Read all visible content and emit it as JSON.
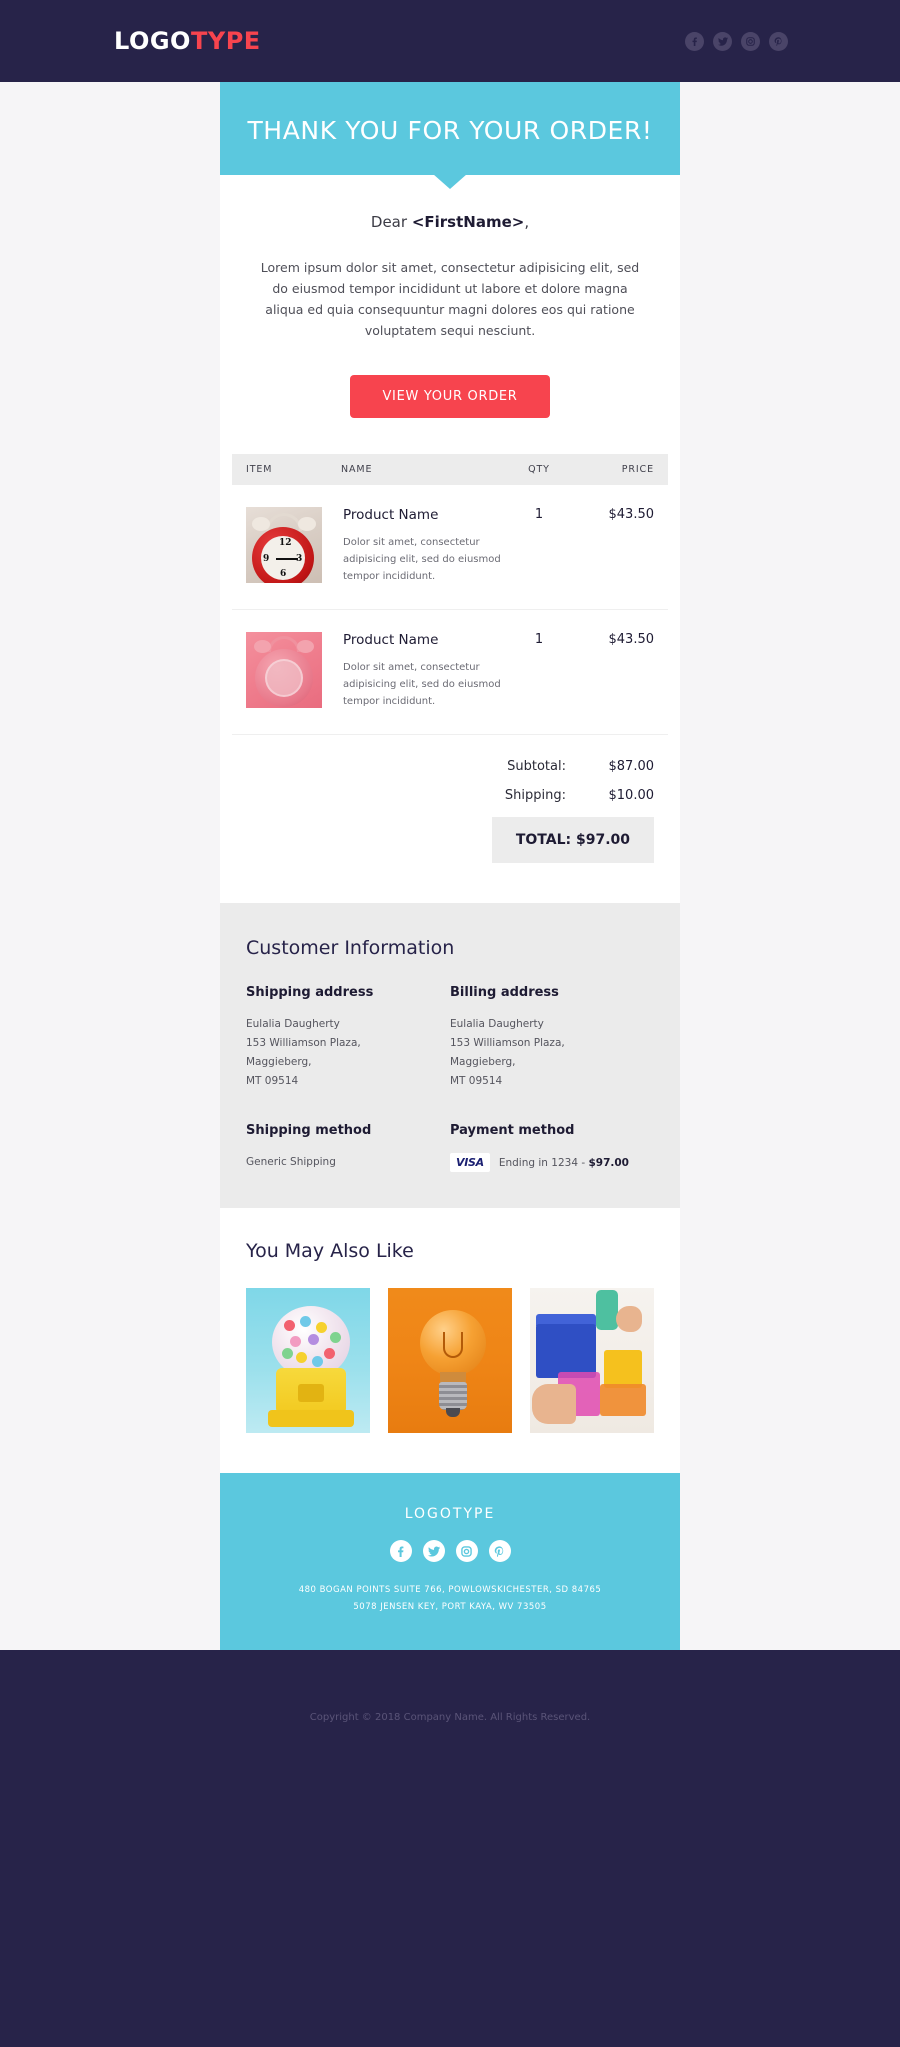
{
  "brand": {
    "logo_primary": "LOGO",
    "logo_accent": "TYPE",
    "accent_color": "#F7444E",
    "cyan_color": "#5BC8DE",
    "navy_color": "#272349"
  },
  "header": {
    "social": [
      {
        "name": "facebook-icon",
        "glyph": "f"
      },
      {
        "name": "twitter-icon",
        "glyph": "t"
      },
      {
        "name": "instagram-icon",
        "glyph": "i"
      },
      {
        "name": "pinterest-icon",
        "glyph": "p"
      }
    ]
  },
  "hero": {
    "title": "THANK YOU FOR YOUR ORDER!"
  },
  "intro": {
    "greeting_prefix": "Dear ",
    "greeting_name": "<FirstName>",
    "greeting_suffix": ",",
    "paragraph": "Lorem ipsum dolor sit amet, consectetur adipisicing elit, sed do eiusmod tempor incididunt ut labore et dolore magna aliqua ed quia consequuntur magni dolores eos qui ratione voluptatem sequi nesciunt.",
    "cta_label": "VIEW YOUR ORDER"
  },
  "order_table": {
    "columns": {
      "item": "ITEM",
      "name": "NAME",
      "qty": "QTY",
      "price": "PRICE"
    },
    "rows": [
      {
        "thumb": "red-alarm-clock-image",
        "name": "Product Name",
        "description": "Dolor sit amet, consectetur adipisicing elit, sed do eiusmod tempor incididunt.",
        "qty": "1",
        "price": "$43.50"
      },
      {
        "thumb": "pink-alarm-clock-image",
        "name": "Product Name",
        "description": "Dolor sit amet, consectetur adipisicing elit, sed do eiusmod tempor incididunt.",
        "qty": "1",
        "price": "$43.50"
      }
    ]
  },
  "totals": {
    "subtotal_label": "Subtotal:",
    "subtotal_value": "$87.00",
    "shipping_label": "Shipping:",
    "shipping_value": "$10.00",
    "grand_total": "TOTAL: $97.00"
  },
  "customer_information": {
    "heading": "Customer Information",
    "shipping_address_label": "Shipping address",
    "shipping_address": "Eulalia Daugherty\n153 Williamson Plaza,\nMaggieberg,\nMT 09514",
    "billing_address_label": "Billing address",
    "billing_address": "Eulalia Daugherty\n153 Williamson Plaza,\nMaggieberg,\nMT 09514",
    "shipping_method_label": "Shipping method",
    "shipping_method": "Generic Shipping",
    "payment_method_label": "Payment method",
    "payment_card_brand": "VISA",
    "payment_detail_prefix": "Ending in 1234 - ",
    "payment_detail_amount": "$97.00"
  },
  "recommendations": {
    "heading": "You May Also Like",
    "items": [
      {
        "name": "gumball-machine-image"
      },
      {
        "name": "orange-lightbulb-image"
      },
      {
        "name": "colorful-blocks-image"
      }
    ]
  },
  "footer": {
    "logo": "LOGOTYPE",
    "social": [
      {
        "name": "facebook-icon"
      },
      {
        "name": "twitter-icon"
      },
      {
        "name": "instagram-icon"
      },
      {
        "name": "pinterest-icon"
      }
    ],
    "address_line_1": "480 BOGAN POINTS SUITE 766, POWLOWSKICHESTER, SD 84765",
    "address_line_2": "5078 JENSEN KEY, PORT KAYA, WV 73505",
    "copyright": "Copyright © 2018 Company Name. All Rights Reserved."
  }
}
